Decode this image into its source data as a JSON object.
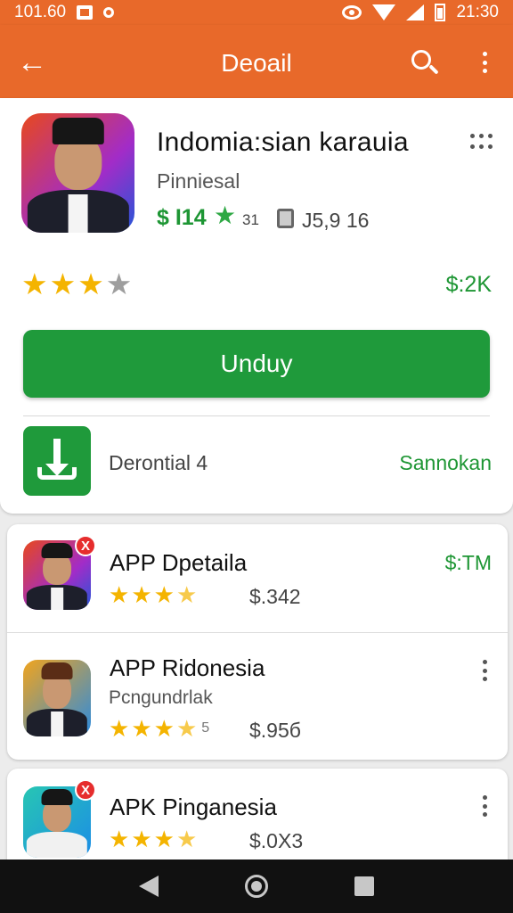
{
  "status_bar": {
    "time_left": "101.60",
    "time_right": "21:30"
  },
  "app_bar": {
    "title": "Deoail"
  },
  "app": {
    "title": "Indomia:sian karauia",
    "developer": "Pinniesal",
    "price": "$ I14",
    "rating_count": "31",
    "size": "J5,9 16",
    "rating": 3,
    "downloads": "$:2K",
    "install_label": "Unduy",
    "download_row_text": "Derontial 4",
    "download_row_link": "Sannokan"
  },
  "list": [
    {
      "title": "APP Dpetaila",
      "subtitle": "",
      "stars": 3.5,
      "count": "",
      "price": "$.342",
      "side_price": "$:TM",
      "badge": "X"
    },
    {
      "title": "APP Ridonesia",
      "subtitle": "Pcngundrlak",
      "stars": 3.5,
      "count": "5",
      "price": "$.95б",
      "side_price": "",
      "badge": ""
    },
    {
      "title": "APK Pinganesia",
      "subtitle": "",
      "stars": 3.5,
      "count": "",
      "price": "$.0Х3",
      "side_price": "",
      "badge": "X"
    }
  ],
  "colors": {
    "accent": "#e8692a",
    "green": "#1f9a3b",
    "star": "#f4b400"
  },
  "icons": [
    "back-arrow-icon",
    "search-icon",
    "more-vert-icon",
    "more-horiz-icon",
    "star-icon",
    "phone-icon",
    "download-icon",
    "nav-back-icon",
    "nav-home-icon",
    "nav-recent-icon"
  ]
}
